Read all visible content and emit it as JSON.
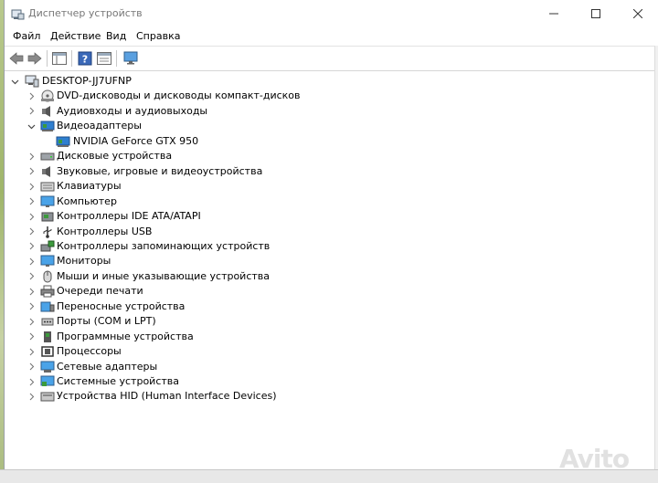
{
  "window": {
    "title": "Диспетчер устройств"
  },
  "menu": [
    "Файл",
    "Действие",
    "Вид",
    "Справка"
  ],
  "tree": {
    "root": "DESKTOP-JJ7UFNP",
    "nodes": [
      {
        "label": "DVD-дисководы и дисководы компакт-дисков",
        "icon": "dvd-icon"
      },
      {
        "label": "Аудиовходы и аудиовыходы",
        "icon": "speaker-icon"
      },
      {
        "label": "Видеоадаптеры",
        "icon": "display-adapter-icon",
        "expanded": true,
        "children": [
          {
            "label": "NVIDIA GeForce GTX 950",
            "icon": "display-adapter-icon"
          }
        ]
      },
      {
        "label": "Дисковые устройства",
        "icon": "disk-drive-icon"
      },
      {
        "label": "Звуковые, игровые и видеоустройства",
        "icon": "speaker-icon"
      },
      {
        "label": "Клавиатуры",
        "icon": "keyboard-icon"
      },
      {
        "label": "Компьютер",
        "icon": "monitor-icon"
      },
      {
        "label": "Контроллеры IDE ATA/ATAPI",
        "icon": "ide-controller-icon"
      },
      {
        "label": "Контроллеры USB",
        "icon": "usb-icon"
      },
      {
        "label": "Контроллеры запоминающих устройств",
        "icon": "storage-controller-icon"
      },
      {
        "label": "Мониторы",
        "icon": "monitor-icon"
      },
      {
        "label": "Мыши и иные указывающие устройства",
        "icon": "mouse-icon"
      },
      {
        "label": "Очереди печати",
        "icon": "printer-icon"
      },
      {
        "label": "Переносные устройства",
        "icon": "portable-device-icon"
      },
      {
        "label": "Порты (COM и LPT)",
        "icon": "port-icon"
      },
      {
        "label": "Программные устройства",
        "icon": "software-device-icon"
      },
      {
        "label": "Процессоры",
        "icon": "processor-icon"
      },
      {
        "label": "Сетевые адаптеры",
        "icon": "network-adapter-icon"
      },
      {
        "label": "Системные устройства",
        "icon": "system-device-icon"
      },
      {
        "label": "Устройства HID (Human Interface Devices)",
        "icon": "hid-icon"
      }
    ]
  },
  "watermark": "Avito",
  "colors": {
    "title_text": "#777777",
    "accent_icon": "#2f7fd0",
    "green_chip": "#3c9a3c"
  }
}
